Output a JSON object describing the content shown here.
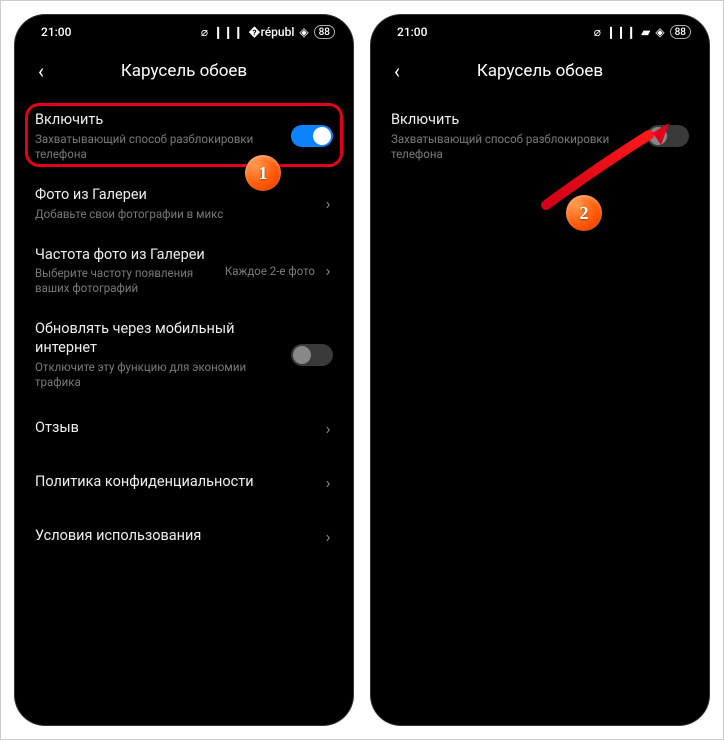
{
  "status": {
    "time": "21:00",
    "battery": "88"
  },
  "header": {
    "title": "Карусель обоев"
  },
  "items": {
    "enable": {
      "title": "Включить",
      "sub": "Захватывающий способ разблокировки телефона"
    },
    "gallery": {
      "title": "Фото из Галереи",
      "sub": "Добавьте свои фотографии в микс"
    },
    "freq": {
      "title": "Частота фото из Галереи",
      "sub": "Выберите частоту появления ваших фотографий",
      "value": "Каждое 2-е фото"
    },
    "mobile": {
      "title": "Обновлять через мобильный интернет",
      "sub": "Отключите эту функцию для экономии трафика"
    },
    "review": {
      "title": "Отзыв"
    },
    "privacy": {
      "title": "Политика конфиденциальности"
    },
    "terms": {
      "title": "Условия использования"
    }
  },
  "markers": {
    "one": "1",
    "two": "2"
  }
}
